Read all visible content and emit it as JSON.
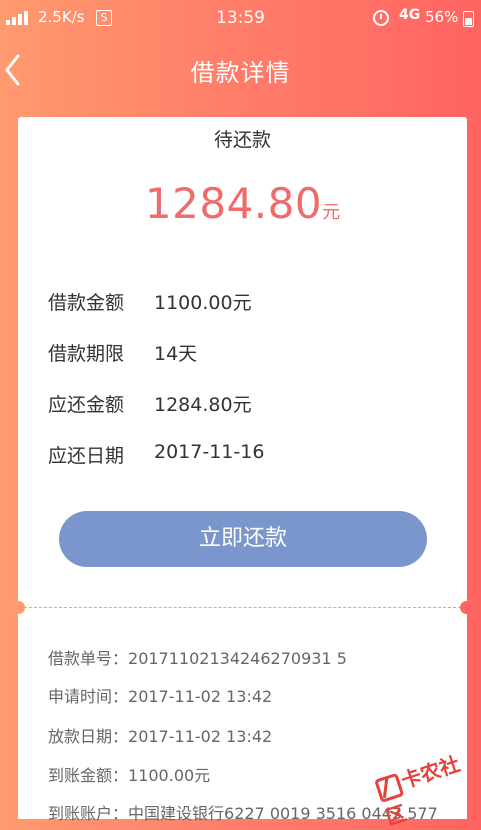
{
  "status_bar": {
    "net_speed": "2.5K/s",
    "speed_icon_glyph": "S",
    "time": "13:59",
    "network": "4G",
    "battery": "56%"
  },
  "nav": {
    "title": "借款详情"
  },
  "loan": {
    "status": "待还款",
    "amount": "1284.80",
    "amount_unit": "元",
    "info": [
      {
        "label": "借款金额",
        "value": "1100.00元"
      },
      {
        "label": "借款期限",
        "value": "14天"
      },
      {
        "label": "应还金额",
        "value": "1284.80元"
      },
      {
        "label": "应还日期",
        "value": "2017-11-16"
      }
    ],
    "repay_button": "立即还款"
  },
  "details": [
    {
      "label": "借款单号：",
      "value": "20171102134246270931 5"
    },
    {
      "label": "申请时间：",
      "value": "2017-11-02 13:42"
    },
    {
      "label": "放款日期：",
      "value": "2017-11-02 13:42"
    },
    {
      "label": "到账金额：",
      "value": "1100.00元"
    },
    {
      "label": "到账账户：",
      "value": "中国建设银行6227 0019 3516 0443 577"
    }
  ],
  "watermark": {
    "text": "卡农社区"
  },
  "colors": {
    "accent": "#f06b6b",
    "button": "#7b96cd",
    "header_start": "#ff9a6e",
    "header_end": "#ff6461"
  }
}
